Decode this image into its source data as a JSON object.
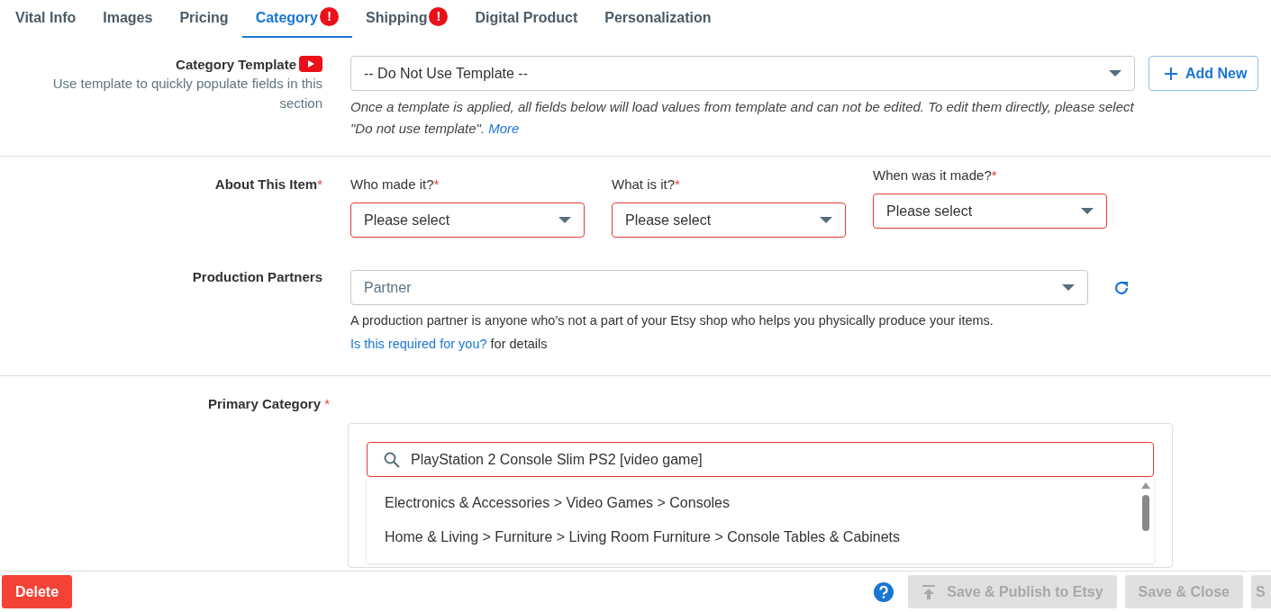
{
  "tabs": [
    {
      "label": "Vital Info",
      "selected": false,
      "error": false
    },
    {
      "label": "Images",
      "selected": false,
      "error": false
    },
    {
      "label": "Pricing",
      "selected": false,
      "error": false
    },
    {
      "label": "Category",
      "selected": true,
      "error": true
    },
    {
      "label": "Shipping",
      "selected": false,
      "error": true
    },
    {
      "label": "Digital Product",
      "selected": false,
      "error": false
    },
    {
      "label": "Personalization",
      "selected": false,
      "error": false
    }
  ],
  "error_badge": "!",
  "category_template": {
    "label": "Category Template",
    "hint": "Use template to quickly populate fields in this section",
    "value": "-- Do Not Use Template --",
    "add_button": "Add New",
    "note": "Once a template is applied, all fields below will load values from template and can not be edited. To edit them directly, please select \"Do not use template\".",
    "more_link": "More"
  },
  "about_item": {
    "label": "About This Item",
    "required_mark": "*",
    "fields": [
      {
        "label": "Who made it?",
        "required_mark": "*",
        "value": "Please select",
        "error": true
      },
      {
        "label": "What is it?",
        "required_mark": "*",
        "value": "Please select",
        "error": true
      },
      {
        "label": "When was it made?",
        "required_mark": "*",
        "value": "Please select",
        "error": true
      }
    ]
  },
  "production_partners": {
    "label": "Production Partners",
    "placeholder": "Partner",
    "note": "A production partner is anyone who’s not a part of your Etsy shop who helps you physically produce your items.",
    "link": "Is this required for you?",
    "note_suffix": "for details"
  },
  "primary_category": {
    "label": "Primary Category",
    "required_mark": "*",
    "search_value": "PlayStation 2 Console Slim PS2 [video game]",
    "results": [
      "Electronics & Accessories > Video Games > Consoles",
      "Home & Living > Furniture > Living Room Furniture > Console Tables & Cabinets"
    ]
  },
  "footer": {
    "delete_button": "Delete",
    "buttons": [
      {
        "label": "Save & Publish to Etsy",
        "disabled": true,
        "kind": "publish"
      },
      {
        "label": "Save & Close",
        "disabled": true,
        "kind": "plain"
      },
      {
        "label": "S",
        "disabled": true,
        "kind": "plain"
      }
    ]
  }
}
